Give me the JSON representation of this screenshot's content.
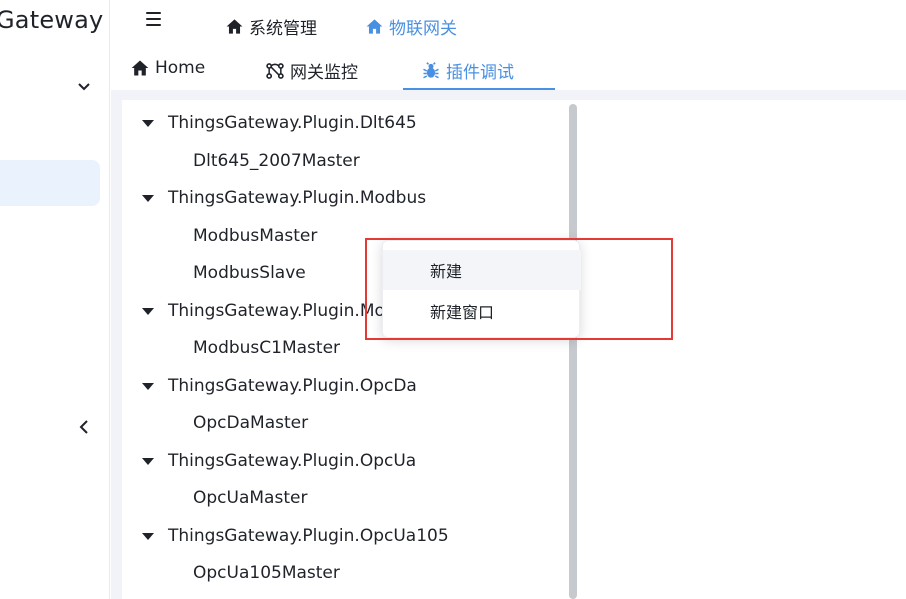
{
  "brand": {
    "title": "Gateway"
  },
  "header": {
    "nav": [
      {
        "label": "系统管理",
        "icon": "home-icon",
        "active": false
      },
      {
        "label": "物联网关",
        "icon": "home-icon",
        "active": true
      }
    ]
  },
  "tabs": [
    {
      "label": "Home",
      "icon": "home-icon",
      "active": false
    },
    {
      "label": "网关监控",
      "icon": "network-icon",
      "active": false
    },
    {
      "label": "插件调试",
      "icon": "bug-icon",
      "active": true
    }
  ],
  "tree": [
    {
      "label": "ThingsGateway.Plugin.Dlt645",
      "children": [
        "Dlt645_2007Master"
      ]
    },
    {
      "label": "ThingsGateway.Plugin.Modbus",
      "children": [
        "ModbusMaster",
        "ModbusSlave"
      ]
    },
    {
      "label": "ThingsGateway.Plugin.Mo",
      "children": [
        "ModbusC1Master"
      ]
    },
    {
      "label": "ThingsGateway.Plugin.OpcDa",
      "children": [
        "OpcDaMaster"
      ]
    },
    {
      "label": "ThingsGateway.Plugin.OpcUa",
      "children": [
        "OpcUaMaster"
      ]
    },
    {
      "label": "ThingsGateway.Plugin.OpcUa105",
      "children": [
        "OpcUa105Master"
      ]
    }
  ],
  "context_menu": {
    "items": [
      "新建",
      "新建窗口"
    ],
    "hovered_index": 0
  },
  "colors": {
    "accent": "#4a90e2",
    "highlight_border": "#e53935"
  }
}
